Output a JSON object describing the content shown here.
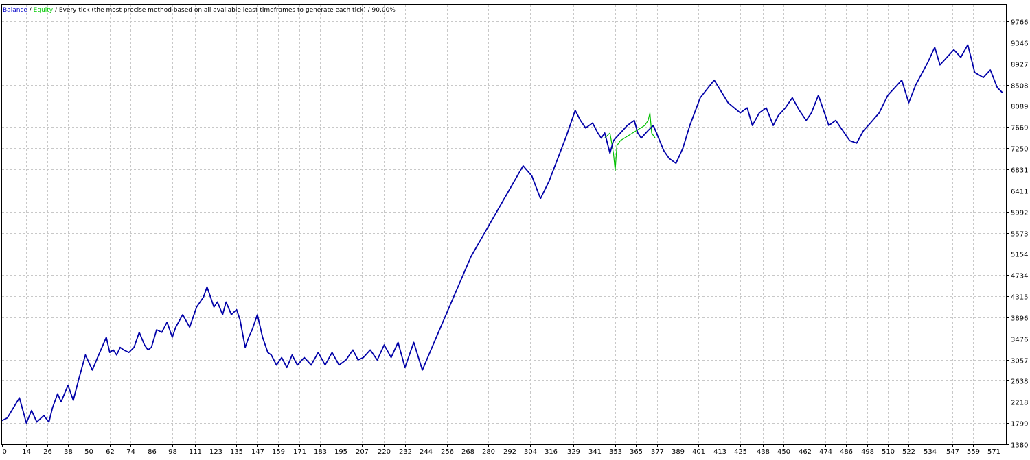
{
  "legend": {
    "balance_label": "Balance",
    "separator": " / ",
    "equity_label": "Equity",
    "method_text": "Every tick (the most precise method based on all available least timeframes to generate each tick)",
    "quality": "90.00%"
  },
  "colors": {
    "balance": "#0000a8",
    "equity": "#00c000",
    "grid": "#c8c8c8",
    "axis": "#000000",
    "background": "#ffffff"
  },
  "chart_data": {
    "type": "line",
    "title": "",
    "xlabel": "",
    "ylabel": "",
    "grid": true,
    "legend_position": "top-left",
    "xlim": [
      0,
      578
    ],
    "ylim": [
      1380,
      9766
    ],
    "x_ticks": [
      0,
      14,
      26,
      38,
      50,
      62,
      74,
      86,
      98,
      111,
      123,
      135,
      147,
      159,
      171,
      183,
      195,
      207,
      220,
      232,
      244,
      256,
      268,
      280,
      292,
      304,
      316,
      329,
      341,
      353,
      365,
      377,
      389,
      401,
      413,
      425,
      438,
      450,
      462,
      474,
      486,
      498,
      510,
      522,
      534,
      547,
      559,
      571
    ],
    "y_ticks": [
      1380,
      1799,
      2218,
      2638,
      3057,
      3476,
      3896,
      4315,
      4734,
      5154,
      5573,
      5992,
      6411,
      6831,
      7250,
      7669,
      8089,
      8508,
      8927,
      9346,
      9766
    ],
    "series": [
      {
        "name": "Balance",
        "x": [
          0,
          3,
          10,
          14,
          17,
          20,
          24,
          27,
          29,
          32,
          34,
          38,
          41,
          44,
          48,
          52,
          55,
          60,
          62,
          64,
          66,
          68,
          70,
          73,
          76,
          79,
          82,
          84,
          86,
          89,
          92,
          95,
          98,
          100,
          104,
          108,
          112,
          116,
          118,
          122,
          124,
          127,
          129,
          132,
          135,
          137,
          140,
          142,
          144,
          147,
          150,
          153,
          155,
          158,
          161,
          164,
          167,
          170,
          174,
          178,
          182,
          186,
          190,
          194,
          198,
          202,
          205,
          208,
          212,
          216,
          220,
          224,
          228,
          232,
          237,
          242,
          250,
          260,
          270,
          280,
          290,
          300,
          305,
          310,
          315,
          320,
          325,
          330,
          333,
          336,
          340,
          343,
          345,
          347,
          350,
          352,
          356,
          360,
          364,
          366,
          368,
          372,
          375,
          378,
          381,
          384,
          388,
          392,
          396,
          402,
          410,
          418,
          425,
          429,
          432,
          436,
          440,
          444,
          447,
          451,
          455,
          459,
          463,
          466,
          470,
          476,
          480,
          484,
          488,
          492,
          496,
          500,
          505,
          510,
          518,
          522,
          526,
          533,
          537,
          540,
          544,
          548,
          552,
          556,
          560,
          565,
          569,
          573,
          576
        ],
        "values": [
          1850,
          1900,
          2300,
          1800,
          2050,
          1820,
          1950,
          1820,
          2100,
          2380,
          2220,
          2550,
          2250,
          2650,
          3150,
          2850,
          3100,
          3500,
          3200,
          3250,
          3150,
          3300,
          3250,
          3200,
          3300,
          3600,
          3350,
          3250,
          3300,
          3650,
          3600,
          3800,
          3500,
          3700,
          3950,
          3700,
          4100,
          4300,
          4500,
          4100,
          4200,
          3950,
          4200,
          3950,
          4050,
          3850,
          3300,
          3500,
          3650,
          3950,
          3500,
          3200,
          3150,
          2950,
          3100,
          2900,
          3150,
          2950,
          3100,
          2950,
          3200,
          2950,
          3200,
          2950,
          3050,
          3250,
          3050,
          3100,
          3250,
          3050,
          3350,
          3100,
          3400,
          2900,
          3400,
          2850,
          3500,
          4300,
          5100,
          5700,
          6300,
          6900,
          6700,
          6250,
          6600,
          7050,
          7500,
          8000,
          7800,
          7650,
          7750,
          7550,
          7450,
          7550,
          7150,
          7400,
          7550,
          7700,
          7800,
          7550,
          7450,
          7600,
          7700,
          7450,
          7200,
          7050,
          6950,
          7250,
          7700,
          8250,
          8600,
          8150,
          7950,
          8050,
          7700,
          7950,
          8050,
          7700,
          7900,
          8050,
          8250,
          8000,
          7800,
          7950,
          8300,
          7700,
          7800,
          7600,
          7400,
          7350,
          7600,
          7750,
          7950,
          8300,
          8600,
          8150,
          8500,
          8950,
          9250,
          8900,
          9050,
          9200,
          9050,
          9300,
          8750,
          8650,
          8800,
          8450,
          8350
        ]
      },
      {
        "name": "Equity",
        "x": [
          347,
          350,
          352,
          353,
          354,
          356,
          370,
          372,
          373,
          374,
          376
        ],
        "values": [
          7450,
          7550,
          7150,
          6800,
          7300,
          7400,
          7700,
          7800,
          7950,
          7550,
          7450
        ]
      }
    ]
  }
}
